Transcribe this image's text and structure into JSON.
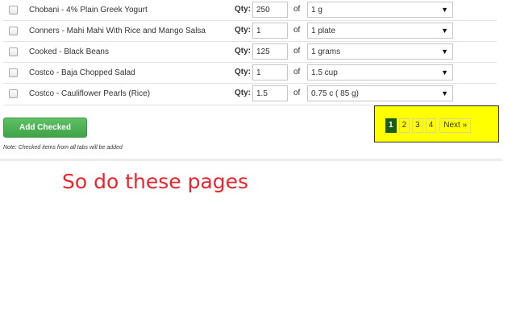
{
  "food_list": {
    "qty_label": "Qty:",
    "of_label": "of",
    "rows": [
      {
        "name": "Chobani - 4% Plain Greek Yogurt",
        "qty": "250",
        "unit": "1 g"
      },
      {
        "name": "Conners - Mahi Mahi With Rice and Mango Salsa",
        "qty": "1",
        "unit": "1 plate"
      },
      {
        "name": "Cooked - Black Beans",
        "qty": "125",
        "unit": "1 grams"
      },
      {
        "name": "Costco - Baja Chopped Salad",
        "qty": "1",
        "unit": "1.5 cup"
      },
      {
        "name": "Costco - Cauliflower Pearls (Rice)",
        "qty": "1.5",
        "unit": "0.75 c ( 85 g)"
      }
    ]
  },
  "actions": {
    "add_checked_label": "Add Checked",
    "note": "Note: Checked items from all tabs will be added"
  },
  "pagination": {
    "pages": [
      "1",
      "2",
      "3",
      "4"
    ],
    "current_page": "1",
    "next_label": "Next »",
    "highlight_color": "#ffff00"
  },
  "annotation": {
    "text": "So do these pages",
    "color": "#e8262e"
  },
  "colors": {
    "button_green": "#4cae4f",
    "active_page": "#1b5b1b"
  },
  "icons": {
    "select_caret": "▼"
  }
}
